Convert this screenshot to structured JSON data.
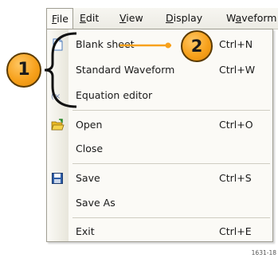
{
  "menubar": {
    "items": [
      {
        "label": "File",
        "underline": "F",
        "rest": "ile",
        "active": true
      },
      {
        "label": "Edit",
        "underline": "E",
        "rest": "dit"
      },
      {
        "label": "View",
        "underline": "V",
        "rest": "iew"
      },
      {
        "label": "Display",
        "underline": "D",
        "rest": "isplay"
      },
      {
        "label": "Waveform",
        "underline": "a",
        "pre": "W",
        "rest": "veform"
      }
    ]
  },
  "file_menu": {
    "items": [
      {
        "label": "Blank sheet",
        "shortcut": "Ctrl+N",
        "icon": "blank-sheet-icon"
      },
      {
        "label": "Standard Waveform",
        "shortcut": "Ctrl+W",
        "icon": ""
      },
      {
        "label": "Equation editor",
        "shortcut": "",
        "icon": "equation-editor-icon"
      },
      {
        "label": "Open",
        "shortcut": "Ctrl+O",
        "icon": "open-folder-icon"
      },
      {
        "label": "Close",
        "shortcut": "",
        "icon": ""
      },
      {
        "label": "Save",
        "shortcut": "Ctrl+S",
        "icon": "save-disk-icon"
      },
      {
        "label": "Save As",
        "shortcut": "",
        "icon": ""
      },
      {
        "label": "Exit",
        "shortcut": "Ctrl+E",
        "icon": ""
      }
    ]
  },
  "callouts": {
    "one": "1",
    "two": "2",
    "color": "#f7a11c"
  },
  "figure_id": "1631-18"
}
